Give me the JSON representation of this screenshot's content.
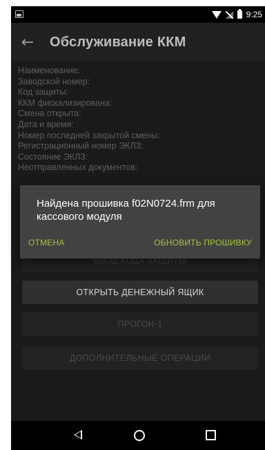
{
  "status_bar": {
    "time": "9:25",
    "icons": [
      "notification-icon",
      "wifi-icon",
      "signal-icon",
      "battery-icon"
    ]
  },
  "app_bar": {
    "back_icon": "←",
    "title": "Обслуживание ККМ"
  },
  "info_fields": [
    "Наименование:",
    "Заводской номер:",
    "Код защиты:",
    "ККМ фискализирована:",
    "Смена открыта:",
    "Дата и время:",
    "Номер последней закрытой смены:",
    "Регистрационный номер ЭКЛЗ:",
    "Состояние ЭКЛЗ:",
    "Неотправленных документов:"
  ],
  "buttons": {
    "enter_code": "ВВОД КОДА ЗАЩИТЫ",
    "open_drawer": "ОТКРЫТЬ ДЕНЕЖНЫЙ ЯЩИК",
    "run": "ПРОГОН-1",
    "extra_ops": "ДОПОЛНИТЕЛЬНЫЕ ОПЕРАЦИИ"
  },
  "dialog": {
    "message": "Найдена прошивка f02N0724.frm для кассового модуля",
    "cancel_label": "ОТМЕНА",
    "update_label": "ОБНОВИТЬ ПРОШИВКУ"
  },
  "colors": {
    "accent": "#a5c63b",
    "dialog_bg": "#424242",
    "app_bar_bg": "#212121"
  }
}
